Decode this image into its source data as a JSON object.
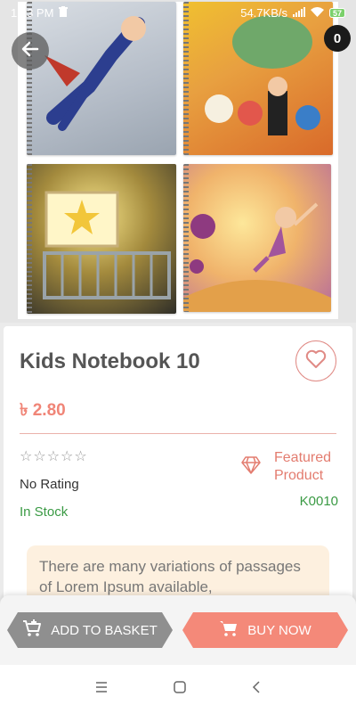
{
  "status_bar": {
    "time": "1:13 PM",
    "network_speed": "54.7KB/s",
    "battery": "57",
    "icons": [
      "trash-icon",
      "signal-icon",
      "wifi-icon",
      "battery-icon"
    ]
  },
  "header": {
    "back_icon": "arrow-left-icon",
    "cart_count": "0"
  },
  "gallery": {
    "items": [
      "superhero-notebook",
      "cartoon-animals-notebook",
      "crib-star-notebook",
      "fairy-girl-notebook"
    ]
  },
  "product": {
    "title": "Kids Notebook 10",
    "price": "৳ 2.80",
    "rating_stars": 0,
    "rating_max": 5,
    "rating_text": "No Rating",
    "stock_status": "In Stock",
    "featured_label": "Featured Product",
    "sku": "K0010",
    "description": "There are many variations of passages of Lorem Ipsum available,"
  },
  "actions": {
    "add_to_basket": "ADD TO BASKET",
    "buy_now": "BUY NOW"
  },
  "colors": {
    "accent": "#f48979",
    "in_stock": "#3a9a44",
    "grey_button": "#8f8f8f"
  }
}
